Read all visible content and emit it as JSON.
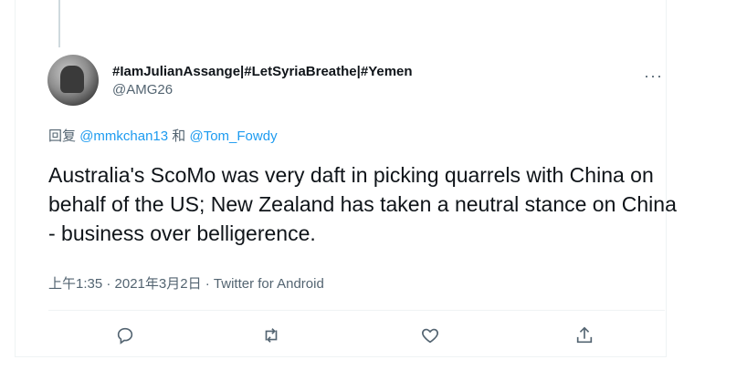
{
  "tweet": {
    "display_name": "#IamJulianAssange|#LetSyriaBreathe|#Yemen",
    "handle": "@AMG26",
    "more_label": "···",
    "reply_prefix": "回复",
    "reply_mention_1": "@mmkchan13",
    "reply_connector": "和",
    "reply_mention_2": "@Tom_Fowdy",
    "text": "Australia's ScoMo was very daft in picking quarrels with China on behalf of the US; New Zealand has taken a neutral stance on China - business over belligerence.",
    "meta": "上午1:35 · 2021年3月2日 · Twitter for Android"
  },
  "actions": {
    "reply_icon": "reply-icon",
    "retweet_icon": "retweet-icon",
    "like_icon": "heart-icon",
    "share_icon": "share-icon"
  },
  "colors": {
    "text": "#0f1419",
    "secondary": "#536471",
    "link": "#1d9bf0",
    "border": "#eff3f4"
  }
}
